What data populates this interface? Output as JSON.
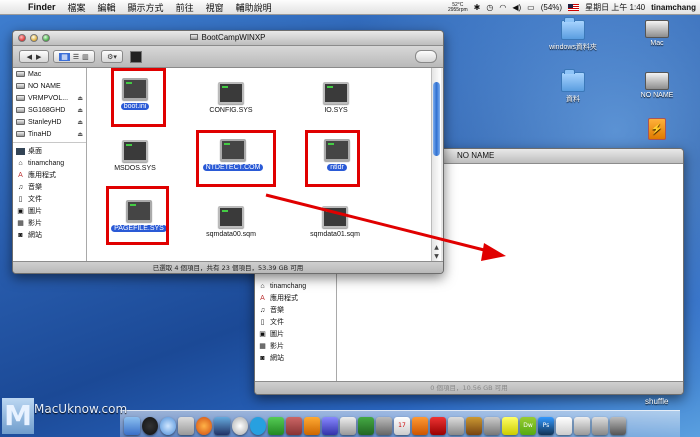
{
  "menubar": {
    "app": "Finder",
    "items": [
      "檔案",
      "編輯",
      "顯示方式",
      "前往",
      "視窗",
      "輔助說明"
    ],
    "temp": "52°C",
    "rpm": "2955rpm",
    "battery": "(54%)",
    "clock": "星期日 上午 1:40",
    "user": "tinamchang"
  },
  "window1": {
    "title": "BootCampWINXP",
    "status": "已選取 4 個項目，共有 23 個項目，53.39 GB 可用",
    "sidebar": {
      "devices": [
        {
          "label": "Mac",
          "eject": false
        },
        {
          "label": "NO NAME",
          "eject": false
        },
        {
          "label": "VRMPVOL...",
          "eject": true
        },
        {
          "label": "SG168GHD",
          "eject": true
        },
        {
          "label": "StanleyHD",
          "eject": true
        },
        {
          "label": "TinaHD",
          "eject": true
        }
      ],
      "places": [
        {
          "label": "桌面",
          "icon": "desktop-icon"
        },
        {
          "label": "tinamchang",
          "icon": "home-icon"
        },
        {
          "label": "應用程式",
          "icon": "applications-icon"
        },
        {
          "label": "音樂",
          "icon": "music-icon"
        },
        {
          "label": "文件",
          "icon": "documents-icon"
        },
        {
          "label": "圖片",
          "icon": "pictures-icon"
        },
        {
          "label": "影片",
          "icon": "movies-icon"
        },
        {
          "label": "網站",
          "icon": "sites-icon"
        }
      ]
    },
    "files": [
      {
        "name": "boot.ini",
        "selected": true
      },
      {
        "name": "CONFIG.SYS",
        "selected": false
      },
      {
        "name": "IO.SYS",
        "selected": false
      },
      {
        "name": "MSDOS.SYS",
        "selected": false
      },
      {
        "name": "NTDETECT.COM",
        "selected": true
      },
      {
        "name": "ntldr",
        "selected": true
      },
      {
        "name": "PAGEFILE.SYS",
        "selected": true
      },
      {
        "name": "sqmdata00.sqm",
        "selected": false
      },
      {
        "name": "sqmdata01.sqm",
        "selected": false
      }
    ]
  },
  "window2": {
    "title": "NO NAME",
    "status": "0 個項目，10.56 GB 可用",
    "sidebar": [
      {
        "label": "tinamchang",
        "icon": "home-icon"
      },
      {
        "label": "應用程式",
        "icon": "applications-icon"
      },
      {
        "label": "音樂",
        "icon": "music-icon"
      },
      {
        "label": "文件",
        "icon": "documents-icon"
      },
      {
        "label": "圖片",
        "icon": "pictures-icon"
      },
      {
        "label": "影片",
        "icon": "movies-icon"
      },
      {
        "label": "網站",
        "icon": "sites-icon"
      }
    ]
  },
  "desktop": {
    "icons": [
      {
        "label": "windows資料夾",
        "kind": "folder"
      },
      {
        "label": "Mac",
        "kind": "disk"
      },
      {
        "label": "資料",
        "kind": "folder"
      },
      {
        "label": "NO NAME",
        "kind": "disk"
      },
      {
        "label": "",
        "kind": "usb"
      }
    ],
    "watermark": "MacUknow.com",
    "shuffle": "shuffle"
  },
  "dock": {
    "items": [
      "finder",
      "dashboard",
      "safari",
      "mail",
      "firefox",
      "ical",
      "itunes",
      "skype",
      "photoshop",
      "acrobat",
      "vlc",
      "dreamweaver",
      "preferences",
      "trash"
    ],
    "labels": [
      "17",
      "Dw",
      "Ps"
    ]
  },
  "colors": {
    "annotation_red": "#e00000",
    "selection_blue": "#2a5ad6",
    "desktop_blue": "#2a5fb0"
  }
}
